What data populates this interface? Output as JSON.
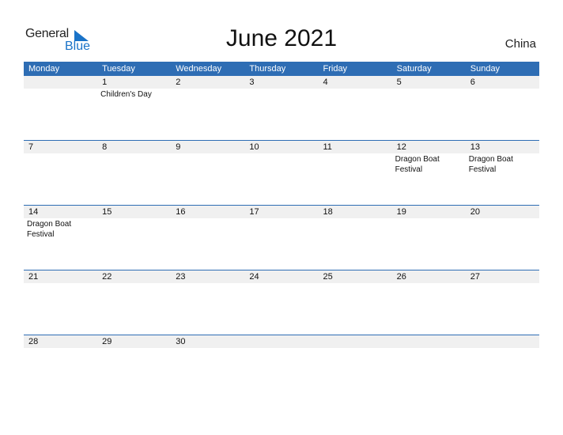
{
  "logo": {
    "general": "General",
    "blue": "Blue"
  },
  "title": "June 2021",
  "country": "China",
  "colors": {
    "accent": "#2e6db4",
    "row_bg": "#f0f0f0"
  },
  "weekdays": [
    "Monday",
    "Tuesday",
    "Wednesday",
    "Thursday",
    "Friday",
    "Saturday",
    "Sunday"
  ],
  "weeks": [
    {
      "days": [
        "",
        "1",
        "2",
        "3",
        "4",
        "5",
        "6"
      ],
      "events": [
        "",
        "Children's Day",
        "",
        "",
        "",
        "",
        ""
      ]
    },
    {
      "days": [
        "7",
        "8",
        "9",
        "10",
        "11",
        "12",
        "13"
      ],
      "events": [
        "",
        "",
        "",
        "",
        "",
        "Dragon Boat Festival",
        "Dragon Boat Festival"
      ]
    },
    {
      "days": [
        "14",
        "15",
        "16",
        "17",
        "18",
        "19",
        "20"
      ],
      "events": [
        "Dragon Boat Festival",
        "",
        "",
        "",
        "",
        "",
        ""
      ]
    },
    {
      "days": [
        "21",
        "22",
        "23",
        "24",
        "25",
        "26",
        "27"
      ],
      "events": [
        "",
        "",
        "",
        "",
        "",
        "",
        ""
      ]
    },
    {
      "days": [
        "28",
        "29",
        "30",
        "",
        "",
        "",
        ""
      ],
      "events": [
        "",
        "",
        "",
        "",
        "",
        "",
        ""
      ]
    }
  ]
}
